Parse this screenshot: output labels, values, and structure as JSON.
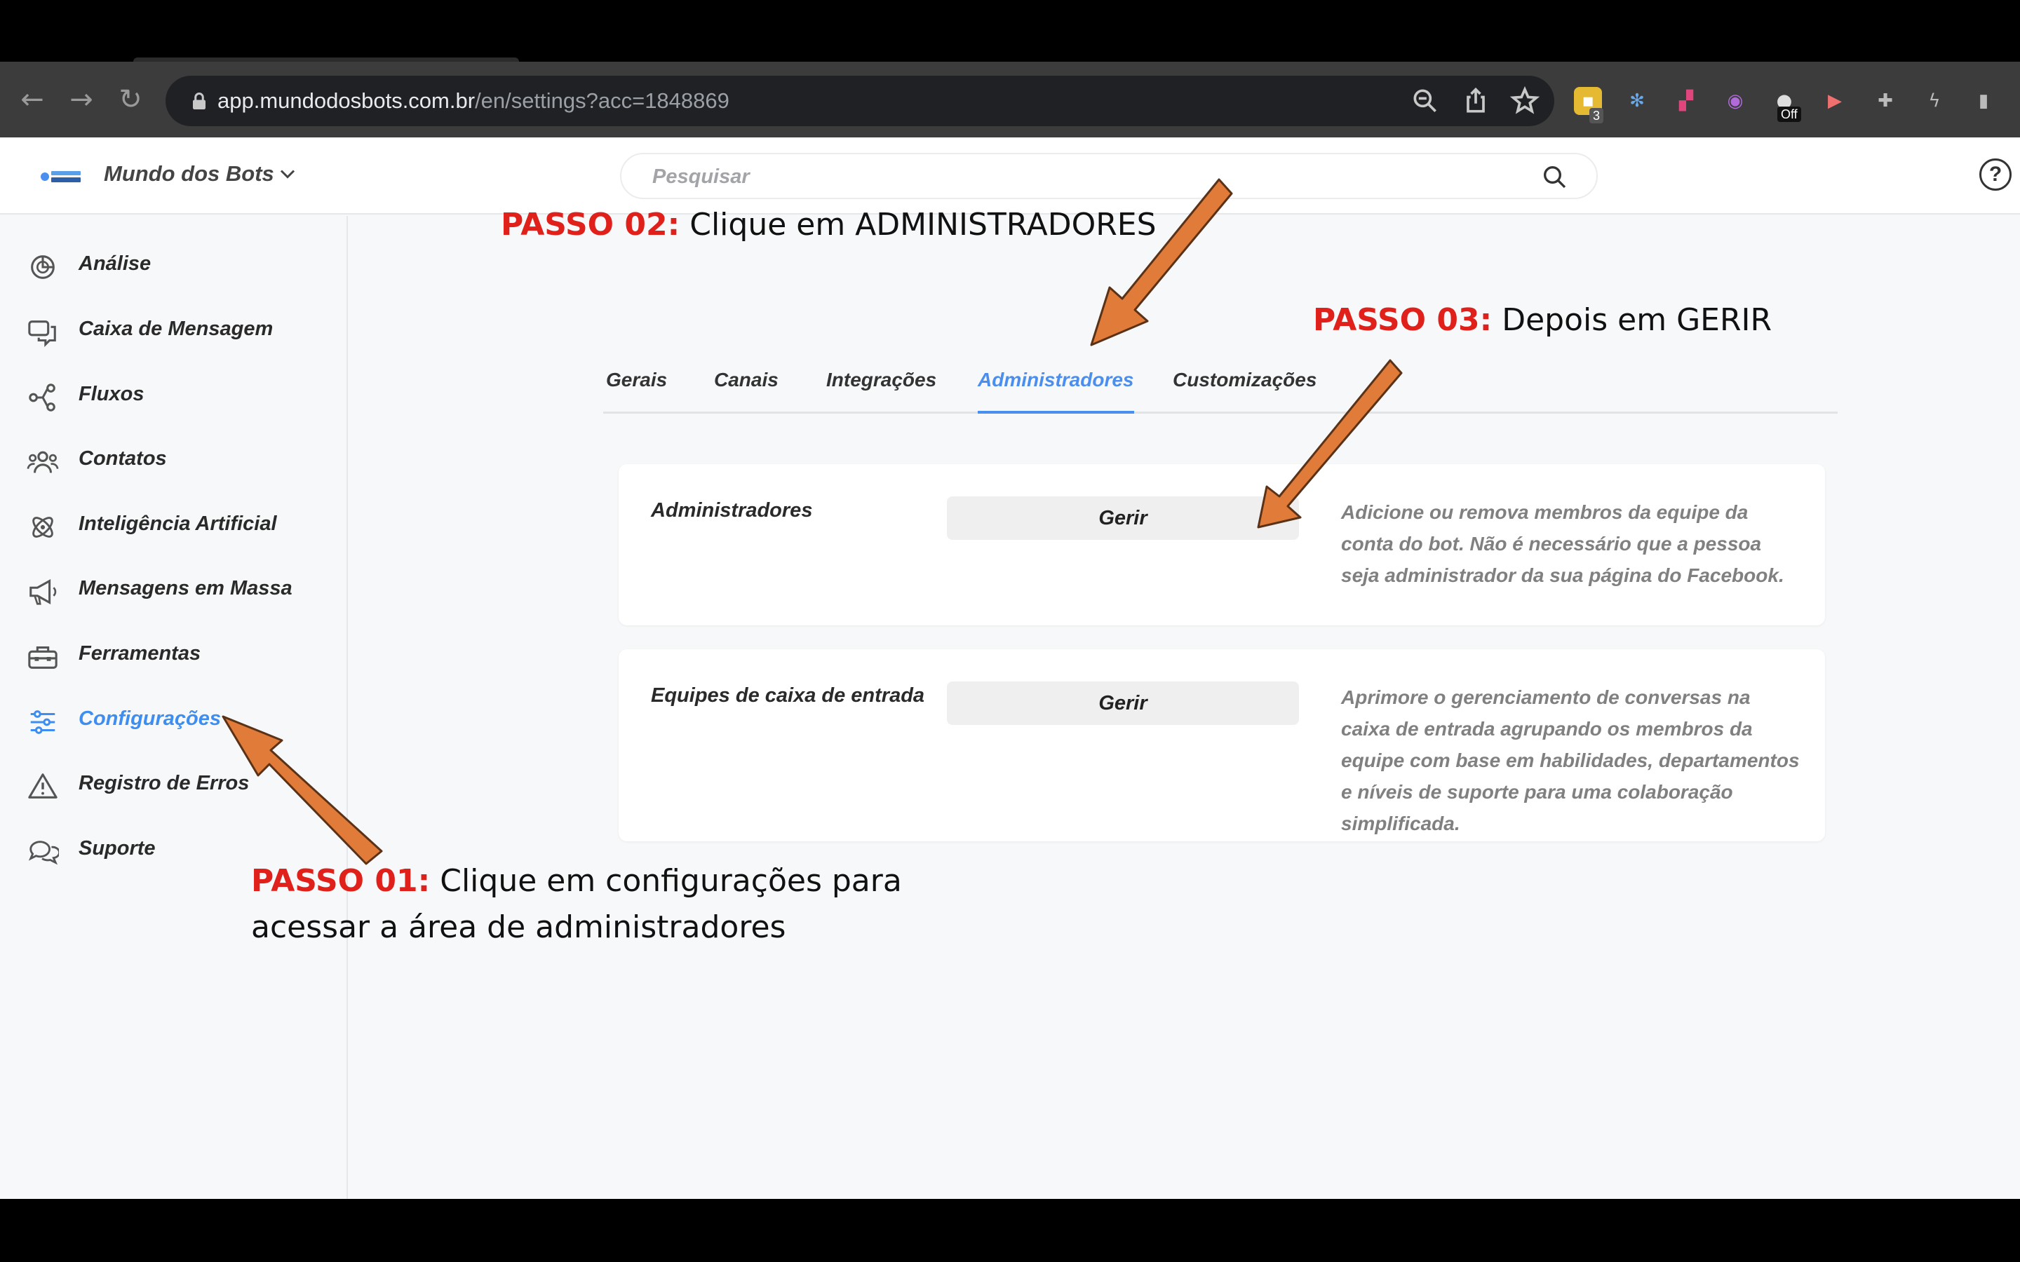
{
  "browser": {
    "url_host": "app.mundodosbots.com.br",
    "url_path": "/en/settings?acc=1848869",
    "extension_badges": [
      "3",
      "Off"
    ]
  },
  "app": {
    "brand": "Mundo dos Bots",
    "logo_text": "MUNDO DOS BOTS",
    "search_placeholder": "Pesquisar",
    "help_glyph": "?"
  },
  "sidebar": {
    "items": [
      {
        "label": "Análise",
        "icon": "pie-chart-icon",
        "active": false
      },
      {
        "label": "Caixa de Mensagem",
        "icon": "chat-bubbles-icon",
        "active": false
      },
      {
        "label": "Fluxos",
        "icon": "flow-share-icon",
        "active": false
      },
      {
        "label": "Contatos",
        "icon": "people-icon",
        "active": false
      },
      {
        "label": "Inteligência Artificial",
        "icon": "atom-icon",
        "active": false
      },
      {
        "label": "Mensagens em Massa",
        "icon": "megaphone-icon",
        "active": false
      },
      {
        "label": "Ferramentas",
        "icon": "toolbox-icon",
        "active": false
      },
      {
        "label": "Configurações",
        "icon": "sliders-icon",
        "active": true
      },
      {
        "label": "Registro de Erros",
        "icon": "warning-icon",
        "active": false
      },
      {
        "label": "Suporte",
        "icon": "support-chat-icon",
        "active": false
      }
    ]
  },
  "tabs": [
    {
      "label": "Gerais",
      "active": false
    },
    {
      "label": "Canais",
      "active": false
    },
    {
      "label": "Integrações",
      "active": false
    },
    {
      "label": "Administradores",
      "active": true
    },
    {
      "label": "Customizações",
      "active": false
    }
  ],
  "cards": [
    {
      "title": "Administradores",
      "button": "Gerir",
      "description": "Adicione ou remova membros da equipe da conta do bot. Não é necessário que a pessoa seja administrador da sua página do Facebook."
    },
    {
      "title": "Equipes de caixa de entrada",
      "button": "Gerir",
      "description": "Aprimore o gerenciamento de conversas na caixa de entrada agrupando os membros da equipe com base em habilidades, departamentos e níveis de suporte para uma colaboração simplificada."
    }
  ],
  "annotations": {
    "step1_label": "PASSO 01:",
    "step1_line1": "Clique em configurações para",
    "step1_line2": "acessar a área de administradores",
    "step2_label": "PASSO 02:",
    "step2_text": "Clique em ADMINISTRADORES",
    "step3_label": "PASSO 03:",
    "step3_text": "Depois em GERIR"
  },
  "colors": {
    "accent_blue": "#3d8ef0",
    "step_red": "#e0201a",
    "arrow_orange": "#e07b39"
  }
}
